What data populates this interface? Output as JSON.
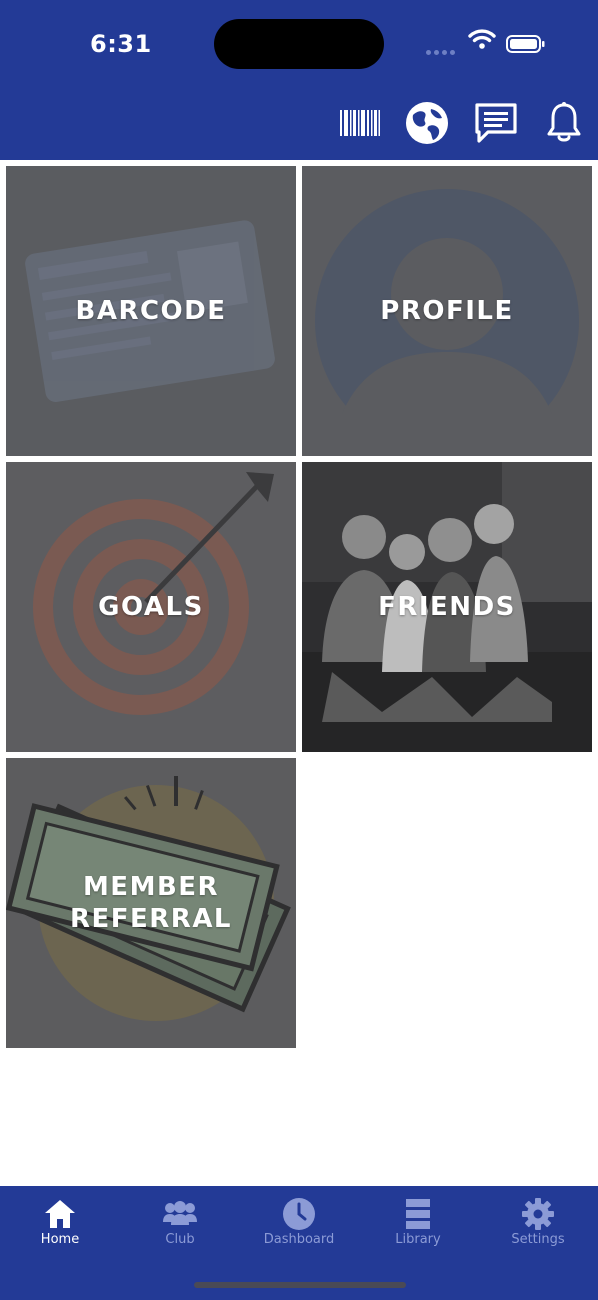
{
  "status_bar": {
    "time": "6:31"
  },
  "header": {
    "icons": [
      "barcode-icon",
      "globe-icon",
      "message-icon",
      "bell-icon"
    ]
  },
  "tiles": [
    {
      "label": "BARCODE",
      "image": "membership-card"
    },
    {
      "label": "PROFILE",
      "image": "person-silhouette"
    },
    {
      "label": "GOALS",
      "image": "target-with-arrow"
    },
    {
      "label": "FRIENDS",
      "image": "group-photo"
    },
    {
      "label": "MEMBER\nREFERRAL",
      "image": "money-bills"
    }
  ],
  "bottom_nav": {
    "items": [
      {
        "label": "Home",
        "icon": "home-icon",
        "active": true
      },
      {
        "label": "Club",
        "icon": "people-icon",
        "active": false
      },
      {
        "label": "Dashboard",
        "icon": "clock-icon",
        "active": false
      },
      {
        "label": "Library",
        "icon": "library-icon",
        "active": false
      },
      {
        "label": "Settings",
        "icon": "gear-icon",
        "active": false
      }
    ]
  },
  "colors": {
    "header": "#233a96",
    "tile_overlay": "#5c5d60",
    "nav_active": "#ffffff",
    "nav_inactive": "#8c9bd6"
  }
}
